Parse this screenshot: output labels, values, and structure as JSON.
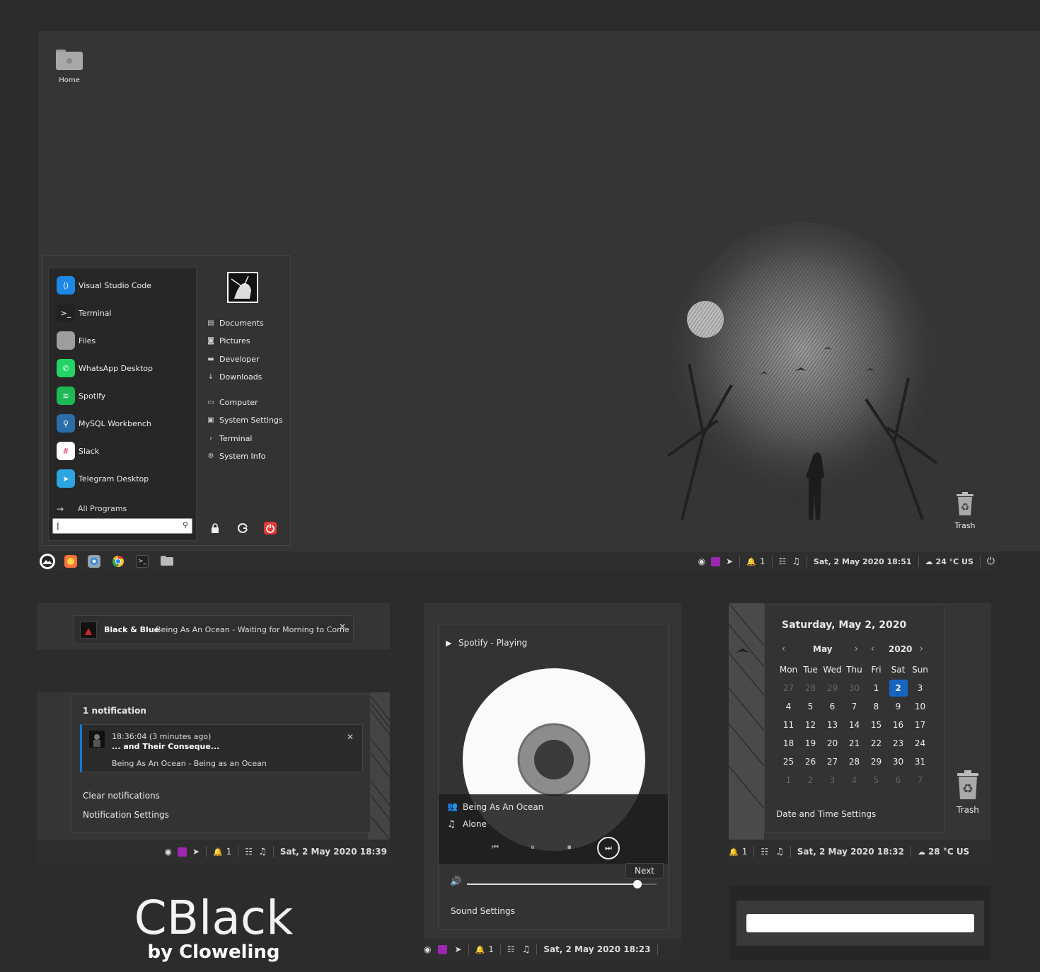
{
  "desktop": {
    "home_icon_label": "Home",
    "trash_label": "Trash"
  },
  "menu": {
    "apps": [
      {
        "label": "Visual Studio Code",
        "icon": "vscode-icon",
        "color": "#1e88e5"
      },
      {
        "label": "Terminal",
        "icon": "terminal-icon",
        "color": "#222222"
      },
      {
        "label": "Files",
        "icon": "folder-icon",
        "color": "#9e9e9e"
      },
      {
        "label": "WhatsApp Desktop",
        "icon": "whatsapp-icon",
        "color": "#25d366"
      },
      {
        "label": "Spotify",
        "icon": "spotify-icon",
        "color": "#1db954"
      },
      {
        "label": "MySQL Workbench",
        "icon": "mysql-icon",
        "color": "#2a6ea8"
      },
      {
        "label": "Slack",
        "icon": "slack-icon",
        "color": "#ffffff"
      },
      {
        "label": "Telegram Desktop",
        "icon": "telegram-icon",
        "color": "#2ca5e0"
      }
    ],
    "all_programs": "All Programs",
    "search_value": "|",
    "places": [
      {
        "label": "Documents",
        "icon": "document-icon"
      },
      {
        "label": "Pictures",
        "icon": "camera-icon"
      },
      {
        "label": "Developer",
        "icon": "folder-icon"
      },
      {
        "label": "Downloads",
        "icon": "download-icon"
      },
      {
        "label": "Computer",
        "icon": "monitor-icon"
      },
      {
        "label": "System Settings",
        "icon": "settings-icon"
      },
      {
        "label": "Terminal",
        "icon": "terminal-icon"
      },
      {
        "label": "System Info",
        "icon": "info-icon"
      }
    ]
  },
  "taskbar": {
    "notif_count": "1",
    "datetime": "Sat,  2 May 2020 18:51",
    "weather": "24 °C  US"
  },
  "notification_toast": {
    "title": "Black & Blue",
    "body": "Being As An Ocean - Waiting for Morning to Come"
  },
  "notifications_panel": {
    "header": "1 notification",
    "time": "18:36:04 (3 minutes ago)",
    "summary": "... and Their Conseque...",
    "body": "Being As An Ocean - Being as an Ocean",
    "clear": "Clear notifications",
    "settings": "Notification Settings",
    "bar_count": "1",
    "bar_datetime": "Sat,  2 May 2020 18:39"
  },
  "player": {
    "status": "Spotify - Playing",
    "artist": "Being As An Ocean",
    "track": "Alone",
    "tooltip": "Next",
    "volume": 0.9,
    "sound_settings": "Sound Settings",
    "bar_count": "1",
    "bar_datetime": "Sat,  2 May 2020 18:23"
  },
  "calendar": {
    "title": "Saturday, May 2, 2020",
    "month": "May",
    "year": "2020",
    "weekdays": [
      "Mon",
      "Tue",
      "Wed",
      "Thu",
      "Fri",
      "Sat",
      "Sun"
    ],
    "weeks": [
      [
        "27",
        "28",
        "29",
        "30",
        "1",
        "2",
        "3"
      ],
      [
        "4",
        "5",
        "6",
        "7",
        "8",
        "9",
        "10"
      ],
      [
        "11",
        "12",
        "13",
        "14",
        "15",
        "16",
        "17"
      ],
      [
        "18",
        "19",
        "20",
        "21",
        "22",
        "23",
        "24"
      ],
      [
        "25",
        "26",
        "27",
        "28",
        "29",
        "30",
        "31"
      ],
      [
        "1",
        "2",
        "3",
        "4",
        "5",
        "6",
        "7"
      ]
    ],
    "settings": "Date and Time Settings",
    "trash_label": "Trash",
    "bar_count": "1",
    "bar_datetime": "Sat,  2 May 2020 18:32",
    "bar_weather": "28 °C  US",
    "accent": "#1565c0"
  },
  "branding": {
    "title": "CBlack",
    "subtitle": "by Cloweling"
  }
}
